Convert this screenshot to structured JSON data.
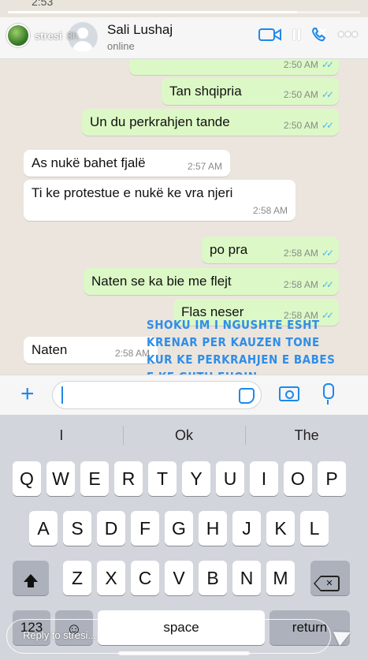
{
  "status": {
    "time": "2:53"
  },
  "story": {
    "username": "stresi",
    "age": "8h",
    "progress": 0.82,
    "overlay_text": "SHOKU IM I NGUSHTE ESHT KRENAR PER KAUZEN TONE KUR KE PERKRAHJEN E BABES E KE GJITH FUQIN",
    "reply_placeholder": "Reply to stresi...",
    "icons": [
      "pause-icon",
      "more-icon",
      "send-icon"
    ]
  },
  "chat_header": {
    "name": "Sali Lushaj",
    "status": "online",
    "icons": [
      "video-call-icon",
      "phone-icon"
    ]
  },
  "messages": [
    {
      "dir": "out",
      "text": "",
      "time": "2:50 AM",
      "ticks": "✓✓"
    },
    {
      "dir": "out",
      "text": "Tan shqipria",
      "time": "2:50 AM",
      "ticks": "✓✓"
    },
    {
      "dir": "out",
      "text": "Un du perkrahjen tande",
      "time": "2:50 AM",
      "ticks": "✓✓"
    },
    {
      "dir": "in",
      "text": "As nukë bahet fjalë",
      "time": "2:57 AM"
    },
    {
      "dir": "in",
      "text": "Ti ke protestue e nukë ke vra njeri",
      "time": "2:58 AM"
    },
    {
      "dir": "out",
      "text": "po pra",
      "time": "2:58 AM",
      "ticks": "✓✓"
    },
    {
      "dir": "out",
      "text": "Naten se ka bie me flejt",
      "time": "2:58 AM",
      "ticks": "✓✓"
    },
    {
      "dir": "out",
      "text": "Flas neser",
      "time": "2:58 AM",
      "ticks": "✓✓"
    },
    {
      "dir": "in",
      "text": "Naten",
      "time": "2:58 AM"
    }
  ],
  "input": {
    "value": ""
  },
  "keyboard": {
    "suggestions": [
      "I",
      "Ok",
      "The"
    ],
    "row1": [
      "Q",
      "W",
      "E",
      "R",
      "T",
      "Y",
      "U",
      "I",
      "O",
      "P"
    ],
    "row2": [
      "A",
      "S",
      "D",
      "F",
      "G",
      "H",
      "J",
      "K",
      "L"
    ],
    "row3": [
      "Z",
      "X",
      "C",
      "V",
      "B",
      "N",
      "M"
    ],
    "numbers_key": "123",
    "space_key": "space",
    "return_key": "return"
  }
}
